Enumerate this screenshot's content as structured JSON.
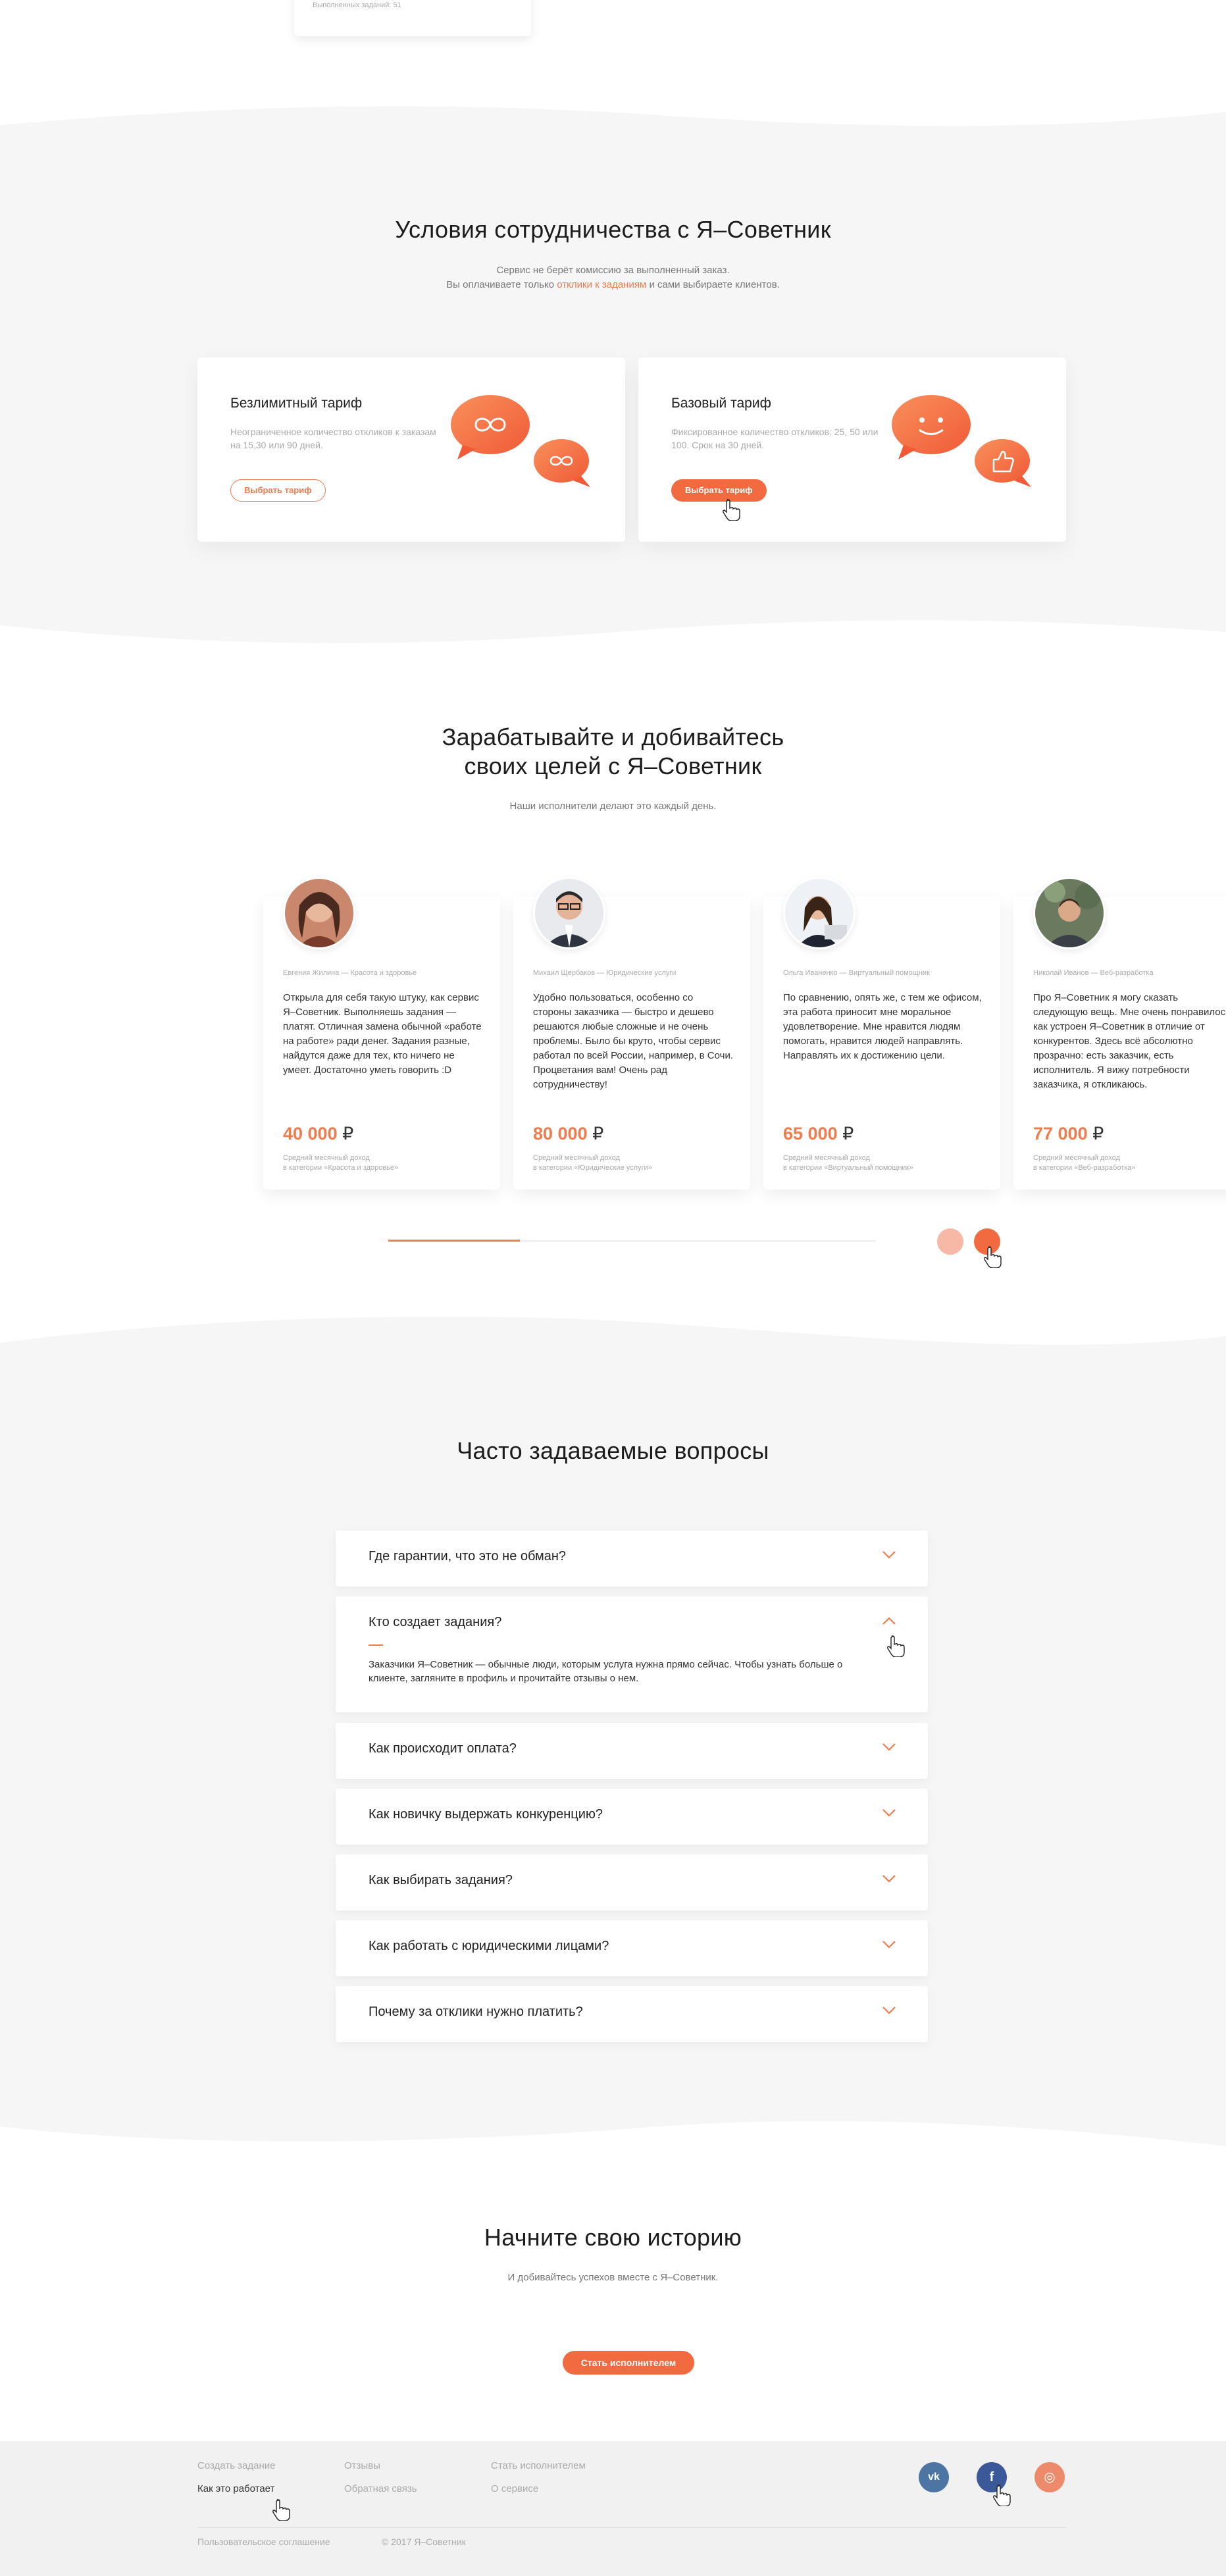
{
  "top_card": {
    "text": "Выполненных заданий: 51"
  },
  "cooperation": {
    "title": "Условия сотрудничества с Я–Советник",
    "sub_line1": "Сервис не берёт комиссию за выполненный заказ.",
    "sub_line2_pre": "Вы оплачиваете только ",
    "sub_line2_link": "отклики к заданиям",
    "sub_line2_post": " и сами выбираете клиентов.",
    "tariffs": [
      {
        "title": "Безлимитный тариф",
        "desc": "Неограниченное количество откликов к заказам на 15,30 или 90 дней.",
        "button": "Выбрать тариф"
      },
      {
        "title": "Базовый тариф",
        "desc": "Фиксированное количество откликов: 25, 50 или 100. Срок на 30 дней.",
        "button": "Выбрать тариф"
      }
    ]
  },
  "earn": {
    "title_line1": "Зарабатывайте и добивайтесь",
    "title_line2": "своих целей с Я–Советник",
    "subtitle": "Наши исполнители делают это каждый день.",
    "testimonials": [
      {
        "who": "Евгения Жилина — Красота и здоровье",
        "quote": "Открыла для себя такую штуку, как сервис Я–Советник. Выполняешь задания — платят. Отличная замена обычной «работе на работе» ради денег. Задания разные, найдутся даже для тех, кто ничего не умеет. Достаточно уметь говорить :D",
        "income": "40 000",
        "currency": "₽",
        "note1": "Средний месячный доход",
        "note2": "в категории «Красота и здоровье»"
      },
      {
        "who": "Михаил Щербаков — Юридические услуги",
        "quote": "Удобно пользоваться, особенно со стороны заказчика — быстро и дешево решаются любые сложные и не очень проблемы. Было бы круто, чтобы сервис работал по всей России, например, в Сочи. Процветания вам! Очень рад сотрудничеству!",
        "income": "80 000",
        "currency": "₽",
        "note1": "Средний месячный доход",
        "note2": "в категории «Юридические услуги»"
      },
      {
        "who": "Ольга Иваненко — Виртуальный помощник",
        "quote": "По сравнению, опять же, с тем же офисом, эта работа приносит мне моральное удовлетворение. Мне нравится людям помогать, нравится людей направлять. Направлять их к достижению цели.",
        "income": "65 000",
        "currency": "₽",
        "note1": "Средний месячный доход",
        "note2": "в категории «Виртуальный помощник»"
      },
      {
        "who": "Николай Иванов — Веб-разработка",
        "quote": "Про Я–Советник я могу сказать следующую вещь. Мне очень понравилось, как устроен Я–Советник в отличие от конкурентов. Здесь всё абсолютно прозрачно: есть заказчик, есть исполнитель. Я вижу потребности заказчика, я откликаюсь.",
        "income": "77 000",
        "currency": "₽",
        "note1": "Средний месячный доход",
        "note2": "в категории «Веб-разработка»"
      }
    ],
    "slider_progress": 0.27
  },
  "faq": {
    "title": "Часто задаваемые вопросы",
    "items": [
      {
        "q": "Где гарантии, что это не обман?",
        "open": false
      },
      {
        "q": "Кто создает задания?",
        "open": true,
        "answer": "Заказчики Я–Советник — обычные люди, которым услуга нужна прямо сейчас. Чтобы узнать больше о клиенте, загляните в профиль и прочитайте отзывы о нем."
      },
      {
        "q": "Как происходит оплата?",
        "open": false
      },
      {
        "q": "Как новичку выдержать конкуренцию?",
        "open": false
      },
      {
        "q": "Как выбирать задания?",
        "open": false
      },
      {
        "q": "Как работать с юридическими лицами?",
        "open": false
      },
      {
        "q": "Почему за отклики нужно платить?",
        "open": false
      }
    ]
  },
  "cta": {
    "title": "Начните свою историю",
    "subtitle": "И добивайтесь успехов вместе с Я–Советник.",
    "button": "Стать исполнителем"
  },
  "footer": {
    "links": {
      "create_task": "Создать задание",
      "how_it_works": "Как это работает",
      "reviews": "Отзывы",
      "feedback": "Обратная связь",
      "become_executor": "Стать исполнителем",
      "about": "О сервисе"
    },
    "agreement": "Пользовательское соглашение",
    "copyright": "© 2017 Я–Советник",
    "social": {
      "vk": "vk",
      "fb": "f",
      "ig": "◎"
    }
  },
  "colors": {
    "accent": "#f26a3f",
    "accent_light": "#f7a48a",
    "vk": "#4c75a3",
    "fb": "#3b5998",
    "ig": "#ee8a6c"
  }
}
